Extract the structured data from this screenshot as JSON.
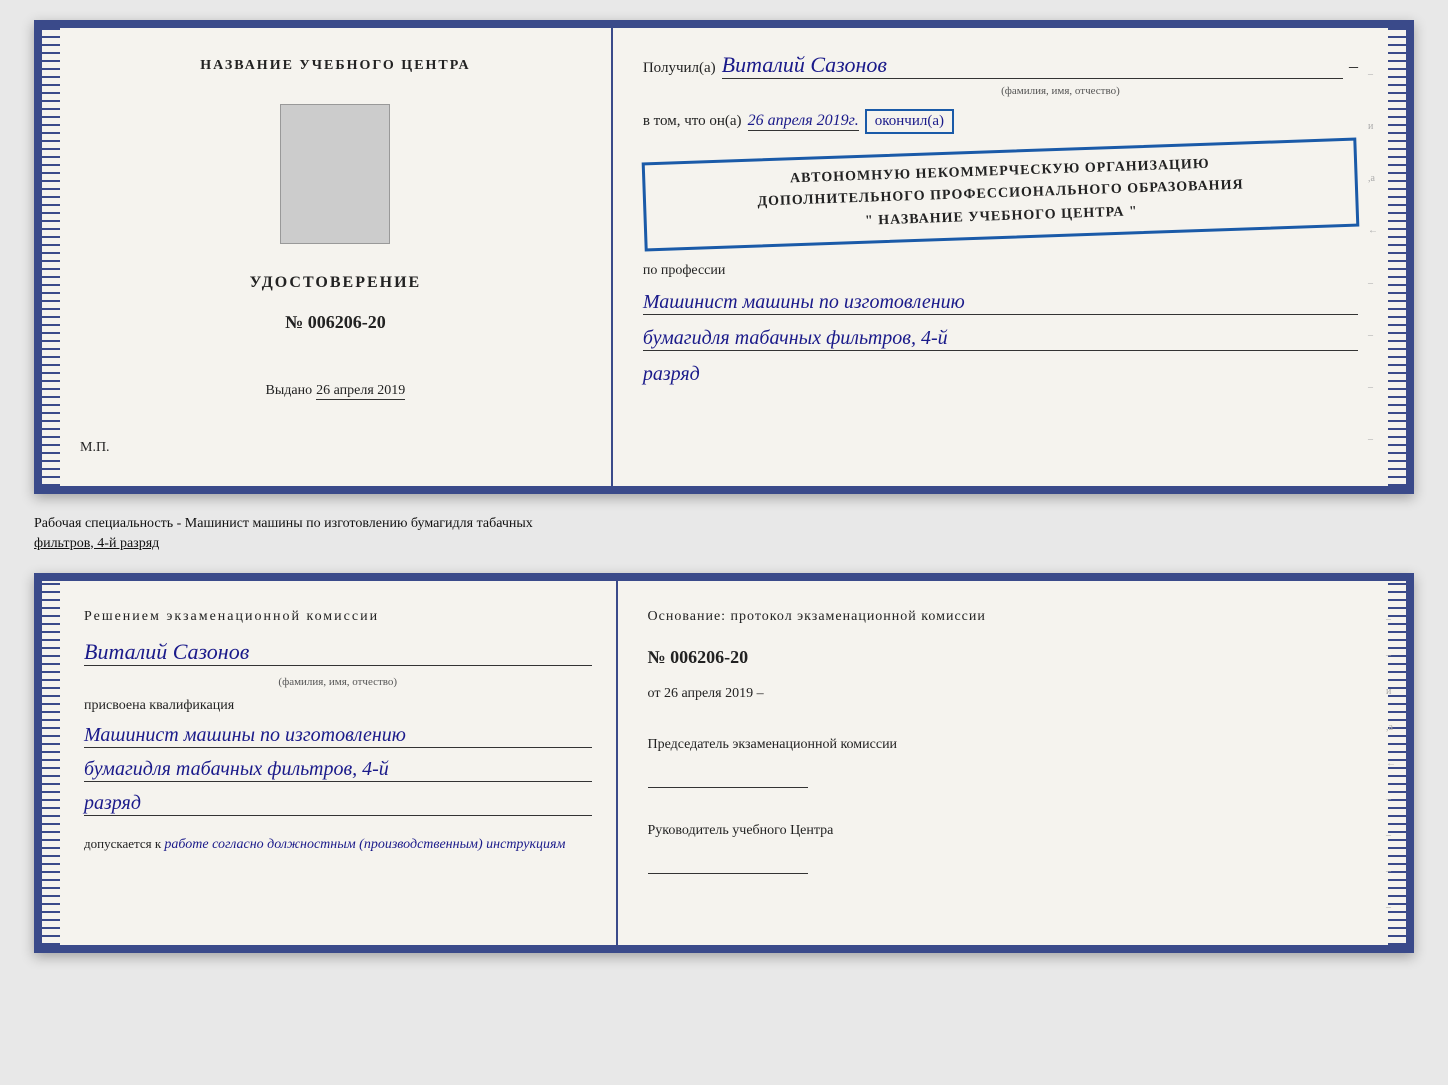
{
  "top_booklet": {
    "left": {
      "title": "НАЗВАНИЕ УЧЕБНОГО ЦЕНТРА",
      "cert_type": "УДОСТОВЕРЕНИЕ",
      "cert_number": "№ 006206-20",
      "issued_label": "Выдано",
      "issued_date": "26 апреля 2019",
      "mp_label": "М.П."
    },
    "right": {
      "received_label": "Получил(а)",
      "recipient_name": "Виталий Сазонов",
      "recipient_dash": "–",
      "fio_subtitle": "(фамилия, имя, отчество)",
      "in_that_label": "в том, что он(а)",
      "date_value": "26 апреля 2019г.",
      "finished_label": "окончил(а)",
      "org_line1": "АВТОНОМНУЮ НЕКОММЕРЧЕСКУЮ ОРГАНИЗАЦИЮ",
      "org_line2": "ДОПОЛНИТЕЛЬНОГО ПРОФЕССИОНАЛЬНОГО ОБРАЗОВАНИЯ",
      "org_line3": "\" НАЗВАНИЕ УЧЕБНОГО ЦЕНТРА \"",
      "profession_label": "по профессии",
      "profession_line1": "Машинист машины по изготовлению",
      "profession_line2": "бумагидля табачных фильтров, 4-й",
      "profession_line3": "разряд"
    }
  },
  "description": {
    "text_part1": "Рабочая специальность - Машинист машины по изготовлению бумагидля табачных",
    "text_part2": "фильтров, 4-й разряд"
  },
  "bottom_booklet": {
    "left": {
      "decision_title": "Решением  экзаменационной  комиссии",
      "person_name": "Виталий Сазонов",
      "fio_label": "(фамилия, имя, отчество)",
      "qualification_label": "присвоена квалификация",
      "qual_line1": "Машинист машины по изготовлению",
      "qual_line2": "бумагидля табачных фильтров, 4-й",
      "qual_line3": "разряд",
      "admitted_label": "допускается к",
      "admitted_value": "работе согласно должностным (производственным) инструкциям"
    },
    "right": {
      "basis_label": "Основание: протокол экзаменационной  комиссии",
      "protocol_number": "№  006206-20",
      "protocol_date_prefix": "от",
      "protocol_date": "26 апреля 2019",
      "chairman_label": "Председатель экзаменационной комиссии",
      "head_label": "Руководитель учебного Центра"
    }
  },
  "right_edge_chars": [
    "–",
    "и",
    ",а",
    "←",
    "–",
    "–",
    "–",
    "–"
  ]
}
